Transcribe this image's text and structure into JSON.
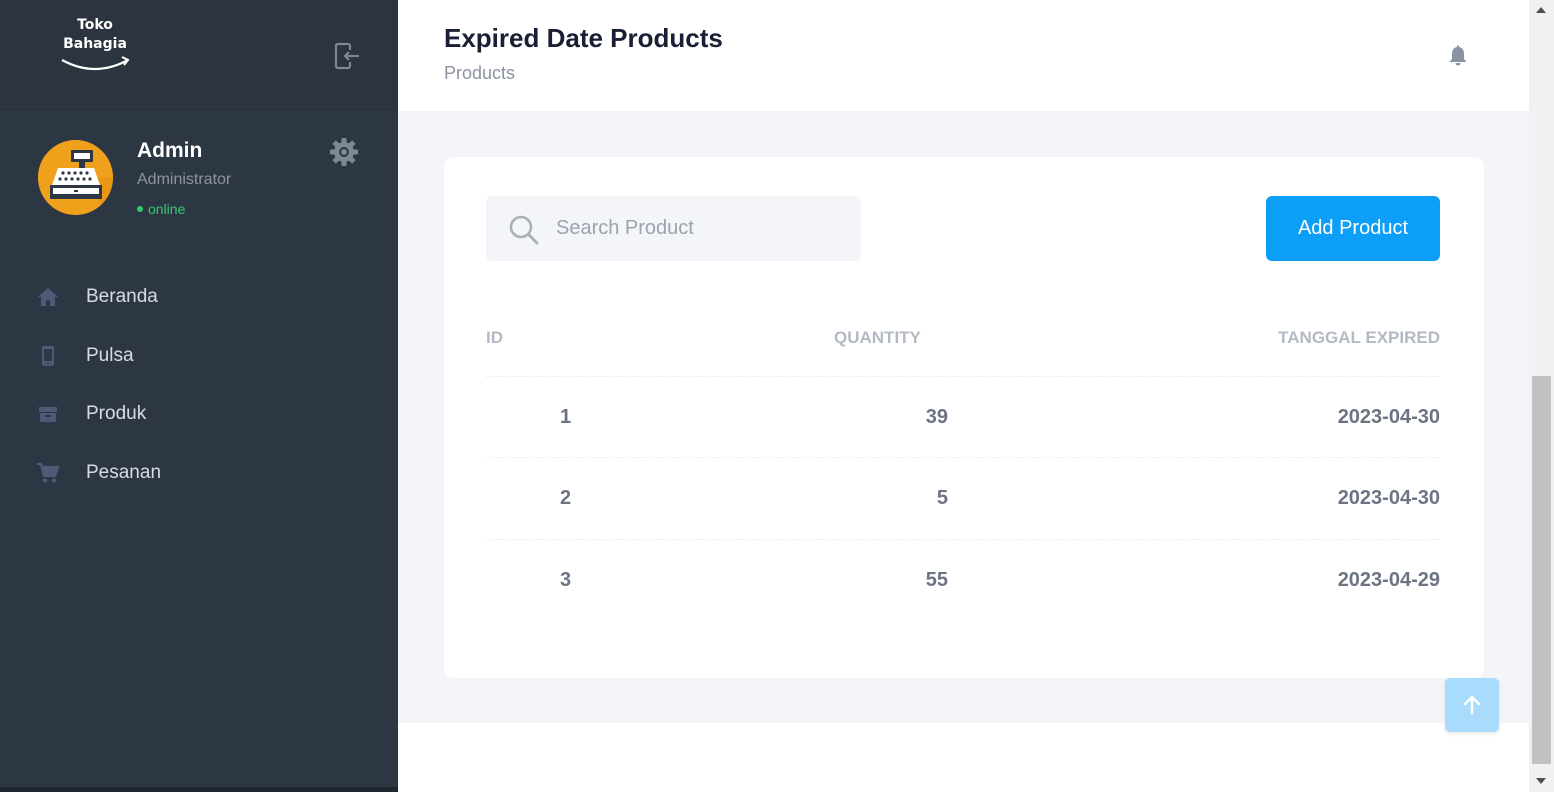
{
  "brand": {
    "line1": "Toko",
    "line2": "Bahagia"
  },
  "profile": {
    "name": "Admin",
    "role": "Administrator",
    "status": "online"
  },
  "nav": [
    {
      "label": "Beranda",
      "icon": "home-icon"
    },
    {
      "label": "Pulsa",
      "icon": "phone-icon"
    },
    {
      "label": "Produk",
      "icon": "box-icon"
    },
    {
      "label": "Pesanan",
      "icon": "cart-icon"
    }
  ],
  "header": {
    "title": "Expired Date Products",
    "breadcrumb": "Products"
  },
  "search": {
    "placeholder": "Search Product",
    "value": ""
  },
  "toolbar": {
    "add_label": "Add Product"
  },
  "table": {
    "headers": {
      "id": "ID",
      "quantity": "QUANTITY",
      "expired": "TANGGAL EXPIRED"
    },
    "rows": [
      {
        "id": "1",
        "quantity": "39",
        "expired": "2023-04-30"
      },
      {
        "id": "2",
        "quantity": "5",
        "expired": "2023-04-30"
      },
      {
        "id": "3",
        "quantity": "55",
        "expired": "2023-04-29"
      }
    ]
  },
  "colors": {
    "sidebar": "#2d3743",
    "accent": "#0d9ef7",
    "online": "#2ecc71",
    "avatar_bg": "#f0a11b"
  }
}
